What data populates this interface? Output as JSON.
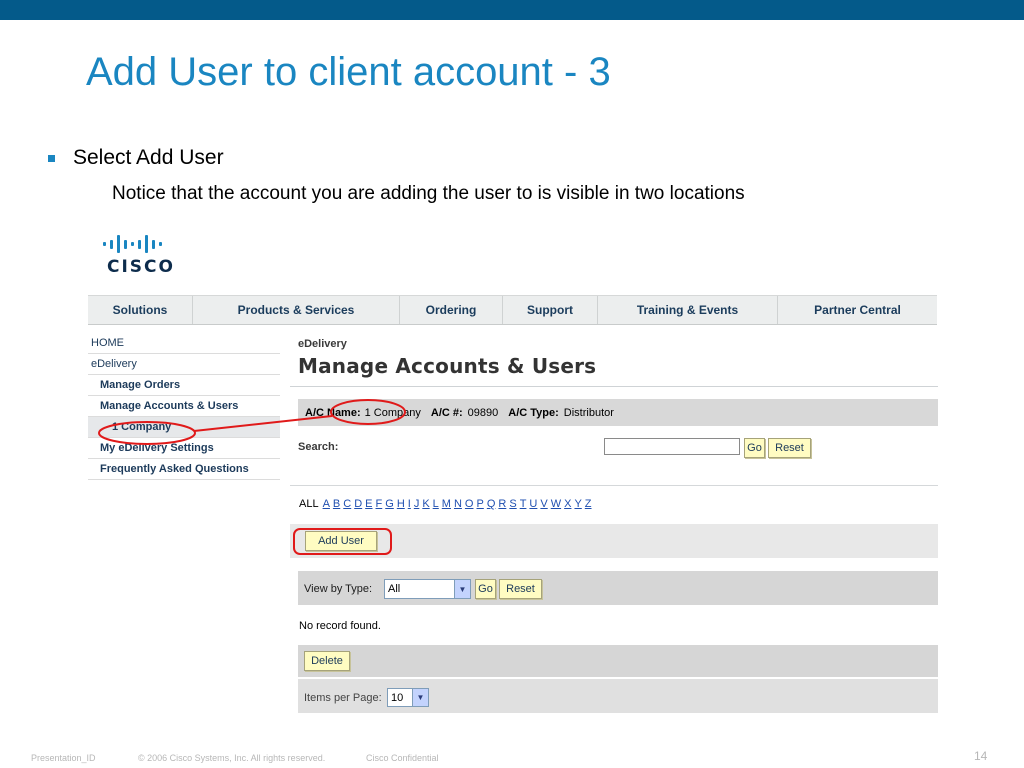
{
  "slide": {
    "title": "Add User to client account - 3",
    "bullet": "Select Add User",
    "subtext": "Notice that the account you are adding the user to is visible in two locations",
    "page_number": "14"
  },
  "footer": {
    "presentation_id": "Presentation_ID",
    "copyright": "© 2006 Cisco Systems, Inc. All rights reserved.",
    "confidential": "Cisco Confidential"
  },
  "logo": {
    "text": "CISCO"
  },
  "colors": {
    "accent": "#1a86c1",
    "topbar": "#045a8a",
    "annotation": "#e01a1a",
    "button_bg": "#fffcc2"
  },
  "navbar": {
    "items": [
      "Solutions",
      "Products & Services",
      "Ordering",
      "Support",
      "Training & Events",
      "Partner Central"
    ]
  },
  "leftnav": {
    "items": [
      "HOME",
      "eDelivery",
      "Manage Orders",
      "Manage Accounts & Users",
      "1 Company",
      "My eDelivery Settings",
      "Frequently Asked Questions"
    ]
  },
  "main": {
    "breadcrumb": "eDelivery",
    "heading": "Manage Accounts & Users",
    "account": {
      "name_label": "A/C Name:",
      "name_value": "1 Company",
      "number_label": "A/C #:",
      "number_value": "09890",
      "type_label": "A/C Type:",
      "type_value": "Distributor"
    },
    "search": {
      "label": "Search:",
      "value": "",
      "go": "Go",
      "reset": "Reset"
    },
    "alphabet": {
      "all": "ALL",
      "letters": [
        "A",
        "B",
        "C",
        "D",
        "E",
        "F",
        "G",
        "H",
        "I",
        "J",
        "K",
        "L",
        "M",
        "N",
        "O",
        "P",
        "Q",
        "R",
        "S",
        "T",
        "U",
        "V",
        "W",
        "X",
        "Y",
        "Z"
      ]
    },
    "add_user": "Add User",
    "view": {
      "label": "View by Type:",
      "selected": "All",
      "go": "Go",
      "reset": "Reset"
    },
    "no_record": "No record found.",
    "delete": "Delete",
    "items_per_page": {
      "label": "Items per Page:",
      "selected": "10"
    }
  }
}
